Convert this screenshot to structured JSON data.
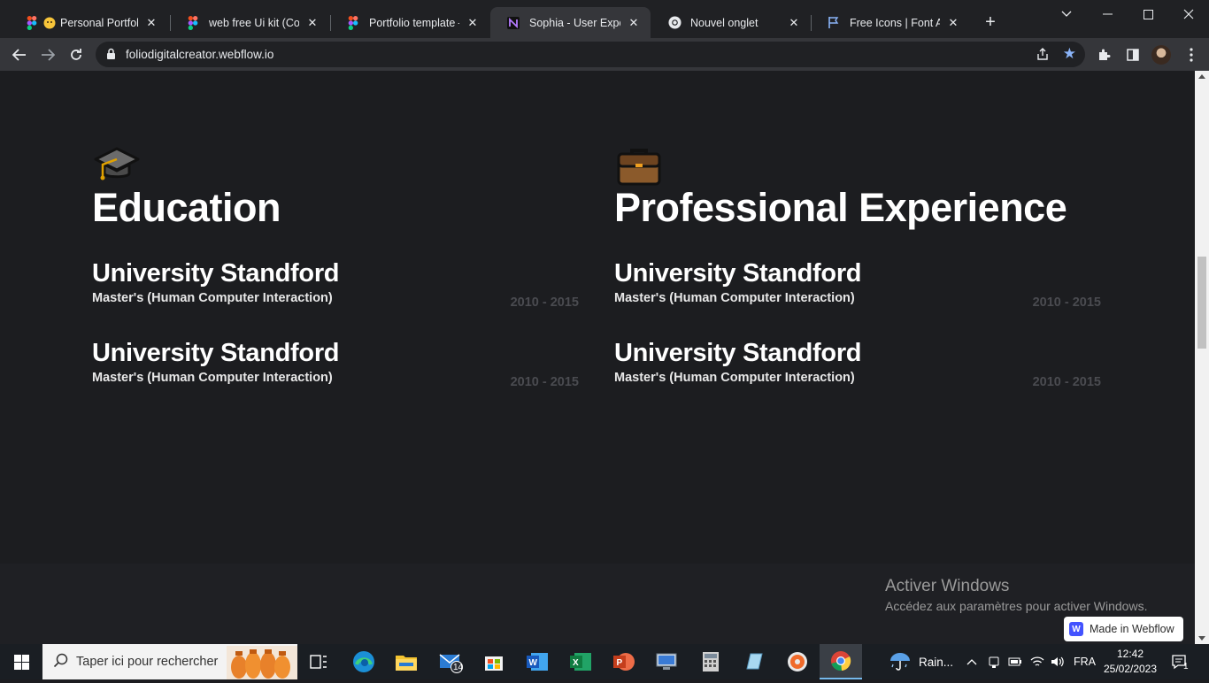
{
  "browser": {
    "tabs": [
      {
        "title": "Personal Portfolio",
        "favicon": "figma-icon",
        "sub": "emoji"
      },
      {
        "title": "web free Ui kit (Comm",
        "favicon": "figma-icon"
      },
      {
        "title": "Portfolio template – Fi",
        "favicon": "figma-icon"
      },
      {
        "title": "Sophia - User Experien",
        "favicon": "webflow-n-icon",
        "active": true
      },
      {
        "title": "Nouvel onglet",
        "favicon": "chrome-icon"
      },
      {
        "title": "Free Icons | Font Awes",
        "favicon": "flag-icon"
      }
    ],
    "url": "foliodigitalcreator.webflow.io"
  },
  "page": {
    "education": {
      "title": "Education",
      "icon": "graduation-cap-icon",
      "entries": [
        {
          "name": "University Standford",
          "degree": "Master's (Human Computer Interaction)",
          "years": "2010 - 2015"
        },
        {
          "name": "University Standford",
          "degree": "Master's (Human Computer Interaction)",
          "years": "2010 - 2015"
        }
      ]
    },
    "experience": {
      "title": "Professional Experience",
      "icon": "briefcase-icon",
      "entries": [
        {
          "name": "University Standford",
          "degree": "Master's (Human Computer Interaction)",
          "years": "2010 - 2015"
        },
        {
          "name": "University Standford",
          "degree": "Master's (Human Computer Interaction)",
          "years": "2010 - 2015"
        }
      ]
    },
    "webflow_badge": "Made in Webflow"
  },
  "overlay": {
    "activate_title": "Activer Windows",
    "activate_sub": "Accédez aux paramètres pour activer Windows."
  },
  "taskbar": {
    "search_placeholder": "Taper ici pour rechercher",
    "mail_badge": "14",
    "weather": "Rain...",
    "language": "FRA",
    "time": "12:42",
    "date": "25/02/2023",
    "notif_count": "1"
  }
}
